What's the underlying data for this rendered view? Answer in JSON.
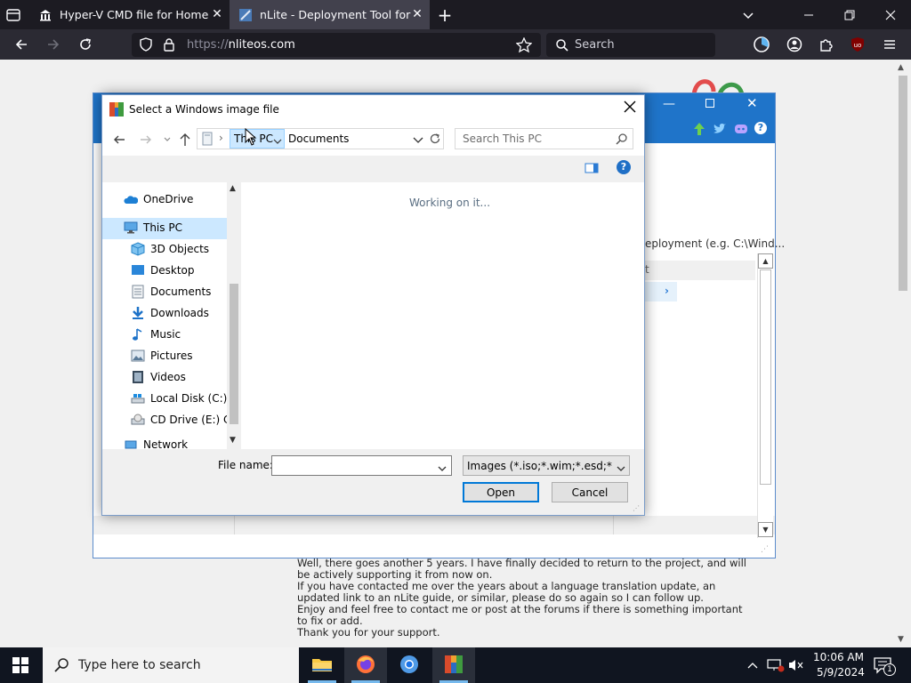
{
  "browser": {
    "tabs": [
      {
        "title": "Hyper-V CMD file for Home SK",
        "active": false
      },
      {
        "title": "nLite - Deployment Tool for the",
        "active": true
      }
    ],
    "url_scheme": "https://",
    "url_host": "nliteos.com",
    "search_placeholder": "Search"
  },
  "nlite": {
    "path_hint": "eployment (e.g. C:\\Wind...",
    "col_letter": "t"
  },
  "dialog": {
    "title": "Select a Windows image file",
    "breadcrumb": [
      "This PC",
      "Documents"
    ],
    "search_placeholder": "Search This PC",
    "status": "Working on it...",
    "nav_items": [
      {
        "label": "OneDrive",
        "icon": "onedrive-icon"
      },
      {
        "label": "This PC",
        "icon": "this-pc-icon"
      },
      {
        "label": "3D Objects",
        "icon": "3d-objects-icon"
      },
      {
        "label": "Desktop",
        "icon": "desktop-icon"
      },
      {
        "label": "Documents",
        "icon": "documents-icon"
      },
      {
        "label": "Downloads",
        "icon": "downloads-icon"
      },
      {
        "label": "Music",
        "icon": "music-icon"
      },
      {
        "label": "Pictures",
        "icon": "pictures-icon"
      },
      {
        "label": "Videos",
        "icon": "videos-icon"
      },
      {
        "label": "Local Disk (C:)",
        "icon": "local-disk-icon"
      },
      {
        "label": "CD Drive (E:) CA",
        "icon": "cd-drive-icon"
      },
      {
        "label": "Network",
        "icon": "network-icon"
      }
    ],
    "file_name_label": "File name:",
    "file_name_value": "",
    "filter_value": "Images (*.iso;*.wim;*.esd;*.swm",
    "open_label": "Open",
    "cancel_label": "Cancel"
  },
  "news": [
    "Well, there goes another 5 years. I have finally decided to return to the project, and will",
    "be actively supporting it from now on.",
    "If you have contacted me over the years about a language translation update, an",
    "updated link to an nLite guide, or similar, please do so again so I can follow up.",
    "Enjoy and feel free to contact me or post at the forums if there is something important",
    "to fix or add.",
    "Thank you for your support."
  ],
  "taskbar": {
    "search_placeholder": "Type here to search",
    "time": "10:06 AM",
    "date": "5/9/2024",
    "notification_count": "1"
  },
  "colors": {
    "nlite_blue": "#1f74c9",
    "browser_dark": "#1c1b22",
    "dialog_accent": "#0078d7"
  }
}
